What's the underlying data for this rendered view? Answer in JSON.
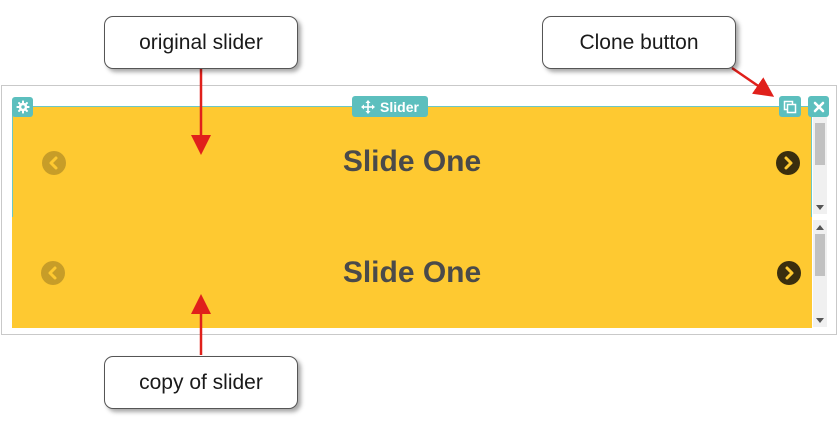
{
  "slider_tab": {
    "label": "Slider"
  },
  "original_slider": {
    "title": "Slide One"
  },
  "copy_slider": {
    "title": "Slide One"
  },
  "callouts": {
    "original": "original slider",
    "clone": "Clone button",
    "copy": "copy of slider"
  },
  "icons": {
    "settings": "gear-icon",
    "move": "move-arrows-icon",
    "clone": "clone-icon",
    "close": "close-icon",
    "prev": "chevron-left-circle-icon",
    "next": "chevron-right-circle-icon"
  },
  "colors": {
    "slide_bg": "#fec931",
    "toolbar": "#5cbfbe",
    "annotation_arrow": "#e0201b"
  }
}
